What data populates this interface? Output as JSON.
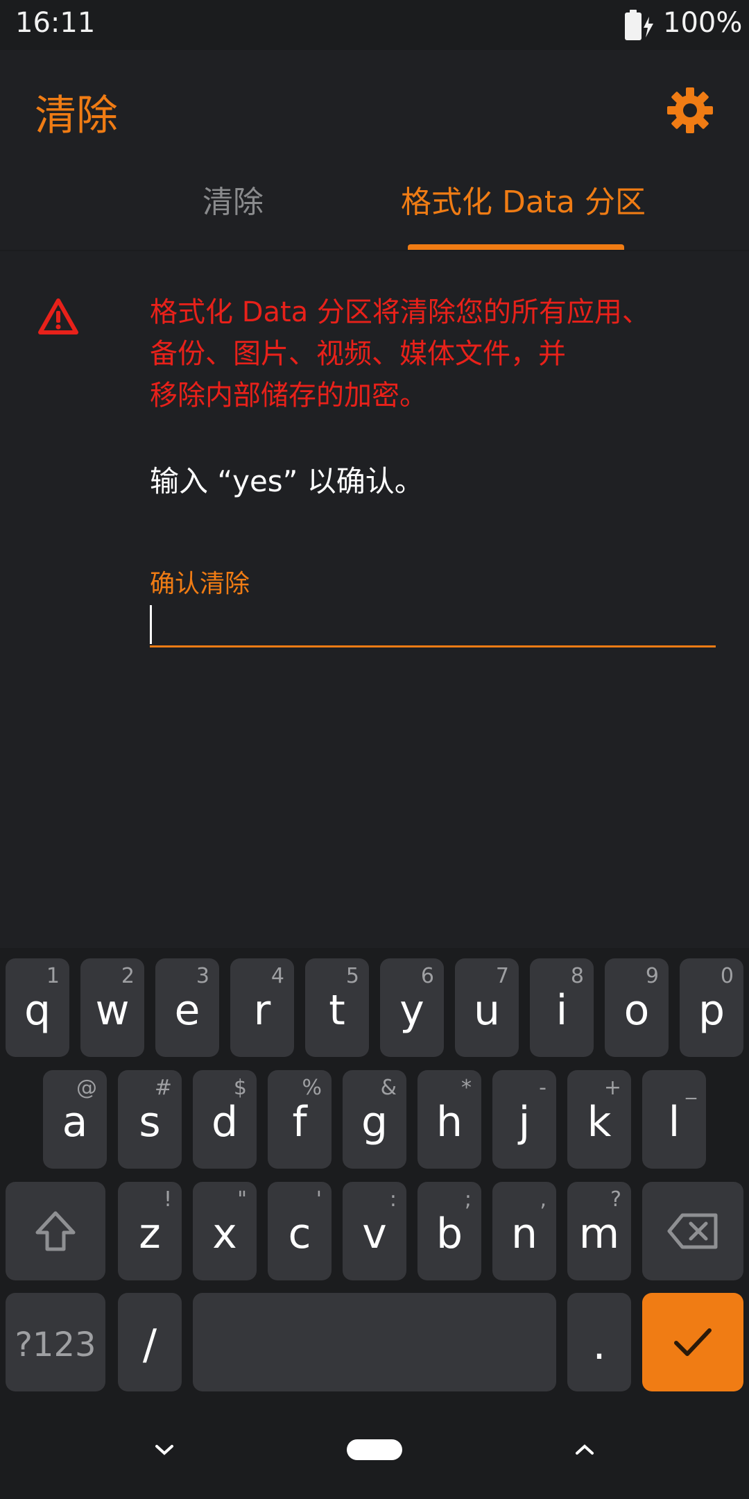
{
  "status_bar": {
    "time": "16:11",
    "battery": "100%"
  },
  "header": {
    "title": "清除"
  },
  "tabs": [
    {
      "label": "清除",
      "selected": false
    },
    {
      "label": "格式化 Data 分区",
      "selected": true
    }
  ],
  "warning": {
    "text": "格式化 Data 分区将清除您的所有应用、\n备份、图片、视频、媒体文件，并\n移除内部储存的加密。"
  },
  "confirm": {
    "hint": "输入 “yes” 以确认。",
    "label": "确认清除",
    "value": ""
  },
  "keyboard": {
    "row1": [
      {
        "k": "q",
        "h": "1"
      },
      {
        "k": "w",
        "h": "2"
      },
      {
        "k": "e",
        "h": "3"
      },
      {
        "k": "r",
        "h": "4"
      },
      {
        "k": "t",
        "h": "5"
      },
      {
        "k": "y",
        "h": "6"
      },
      {
        "k": "u",
        "h": "7"
      },
      {
        "k": "i",
        "h": "8"
      },
      {
        "k": "o",
        "h": "9"
      },
      {
        "k": "p",
        "h": "0"
      }
    ],
    "row2": [
      {
        "k": "a",
        "h": "@"
      },
      {
        "k": "s",
        "h": "#"
      },
      {
        "k": "d",
        "h": "$"
      },
      {
        "k": "f",
        "h": "%"
      },
      {
        "k": "g",
        "h": "&"
      },
      {
        "k": "h",
        "h": "*"
      },
      {
        "k": "j",
        "h": "-"
      },
      {
        "k": "k",
        "h": "+"
      },
      {
        "k": "l",
        "h": "_"
      }
    ],
    "row3": [
      {
        "k": "z",
        "h": "!"
      },
      {
        "k": "x",
        "h": "\""
      },
      {
        "k": "c",
        "h": "'"
      },
      {
        "k": "v",
        "h": ":"
      },
      {
        "k": "b",
        "h": ";"
      },
      {
        "k": "n",
        "h": ","
      },
      {
        "k": "m",
        "h": "?"
      }
    ],
    "symbols_label": "?123",
    "slash_label": "/",
    "period_label": "."
  },
  "colors": {
    "accent": "#f07c14",
    "warning": "#e8211a",
    "background": "#1f2023",
    "key": "#36373b"
  },
  "icons": {
    "settings": "gear-icon",
    "warning": "warning-triangle-icon",
    "battery": "battery-charging-icon",
    "shift": "shift-icon",
    "backspace": "backspace-icon",
    "enter": "checkmark-icon"
  }
}
